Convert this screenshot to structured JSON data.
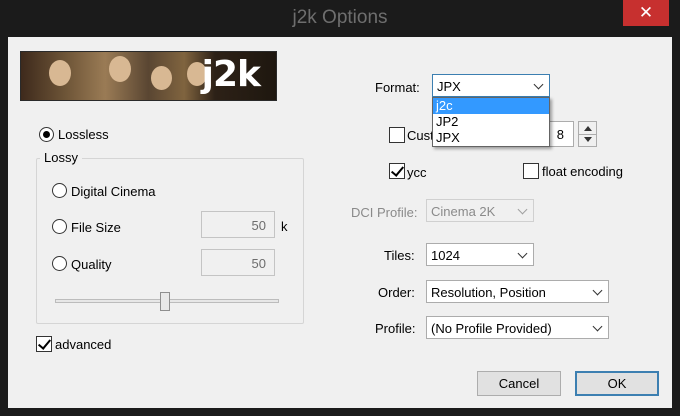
{
  "window": {
    "title": "j2k Options",
    "close_glyph": "✕"
  },
  "banner": {
    "logo_text": "j2k"
  },
  "modes": {
    "lossless_label": "Lossless",
    "lossless_selected": true,
    "lossy_group_title": "Lossy",
    "digital_cinema_label": "Digital Cinema",
    "file_size_label": "File Size",
    "file_size_value": "50",
    "file_size_unit": "k",
    "quality_label": "Quality",
    "quality_value": "50",
    "quality_level_fraction": 0.5
  },
  "advanced": {
    "label": "advanced",
    "checked": true
  },
  "format": {
    "label": "Format:",
    "selected": "JPX",
    "options": [
      "j2c",
      "JP2",
      "JPX"
    ],
    "highlighted": "j2c"
  },
  "custom": {
    "label_visible": "Cust",
    "checked": false,
    "spin_value": "8"
  },
  "ycc": {
    "label": "ycc",
    "checked": true
  },
  "float_encoding": {
    "label": "float encoding",
    "checked": false
  },
  "dci_profile": {
    "label": "DCI Profile:",
    "value": "Cinema 2K",
    "enabled": false
  },
  "tiles": {
    "label": "Tiles:",
    "value": "1024"
  },
  "order": {
    "label": "Order:",
    "value": "Resolution, Position"
  },
  "profile": {
    "label": "Profile:",
    "value": "(No Profile Provided)"
  },
  "buttons": {
    "cancel": "Cancel",
    "ok": "OK"
  },
  "colors": {
    "accent": "#3399ff",
    "close": "#c7302f",
    "titlebar": "#1b1b1b",
    "dialog": "#f0f0f0"
  },
  "icons": {
    "close": "close-icon",
    "combo": "chevron-down-icon",
    "spin_up": "arrow-up-icon",
    "spin_down": "arrow-down-icon",
    "check": "checkmark-icon"
  }
}
